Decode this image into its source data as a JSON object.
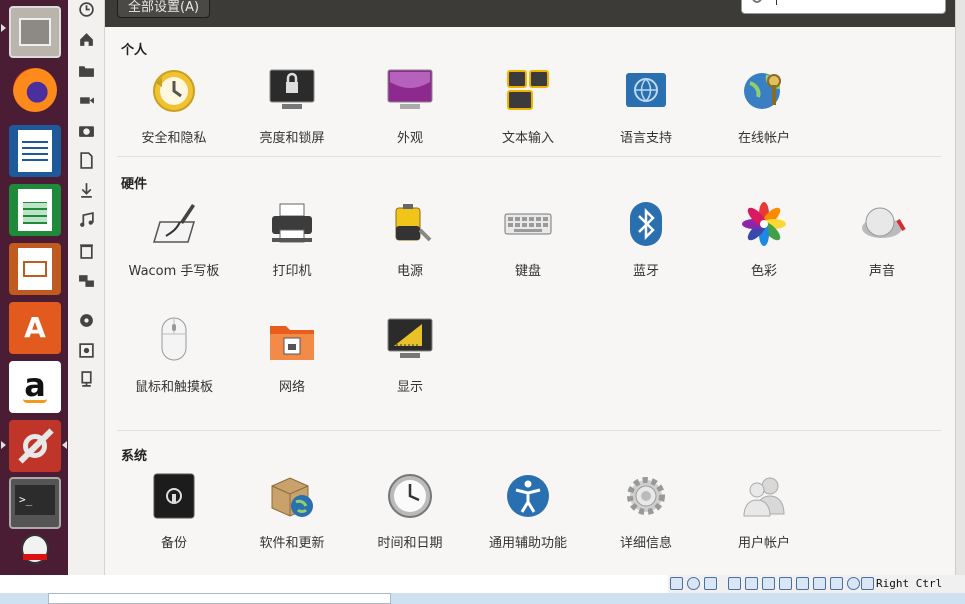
{
  "header": {
    "all_settings_label": "全部设置(A)",
    "search_placeholder": ""
  },
  "sections": {
    "personal": {
      "title": "个人",
      "items": [
        {
          "label": "安全和隐私",
          "icon": "security-privacy-icon"
        },
        {
          "label": "亮度和锁屏",
          "icon": "brightness-lock-icon"
        },
        {
          "label": "外观",
          "icon": "appearance-icon"
        },
        {
          "label": "文本输入",
          "icon": "text-entry-icon"
        },
        {
          "label": "语言支持",
          "icon": "language-support-icon"
        },
        {
          "label": "在线帐户",
          "icon": "online-accounts-icon"
        }
      ]
    },
    "hardware": {
      "title": "硬件",
      "items": [
        {
          "label": "Wacom 手写板",
          "icon": "wacom-tablet-icon"
        },
        {
          "label": "打印机",
          "icon": "printer-icon"
        },
        {
          "label": "电源",
          "icon": "power-icon"
        },
        {
          "label": "键盘",
          "icon": "keyboard-icon"
        },
        {
          "label": "蓝牙",
          "icon": "bluetooth-icon"
        },
        {
          "label": "色彩",
          "icon": "color-icon"
        },
        {
          "label": "声音",
          "icon": "sound-icon"
        },
        {
          "label": "鼠标和触摸板",
          "icon": "mouse-touchpad-icon"
        },
        {
          "label": "网络",
          "icon": "network-icon"
        },
        {
          "label": "显示",
          "icon": "display-icon"
        }
      ]
    },
    "system": {
      "title": "系统",
      "items": [
        {
          "label": "备份",
          "icon": "backup-icon"
        },
        {
          "label": "软件和更新",
          "icon": "software-updates-icon"
        },
        {
          "label": "时间和日期",
          "icon": "time-date-icon"
        },
        {
          "label": "通用辅助功能",
          "icon": "universal-access-icon"
        },
        {
          "label": "详细信息",
          "icon": "details-icon"
        },
        {
          "label": "用户帐户",
          "icon": "user-accounts-icon"
        }
      ]
    }
  },
  "launcher": {
    "items": [
      "files-icon",
      "firefox-icon",
      "writer-icon",
      "calc-icon",
      "impress-icon",
      "software-center-icon",
      "amazon-icon",
      "system-settings-icon",
      "terminal-icon",
      "qq-icon"
    ]
  },
  "tray": {
    "host_key": "Right Ctrl"
  },
  "colors": {
    "launcher_bg": "#4a1d34",
    "header_bg": "#3c3b37",
    "content_bg": "#f7f6f5"
  }
}
